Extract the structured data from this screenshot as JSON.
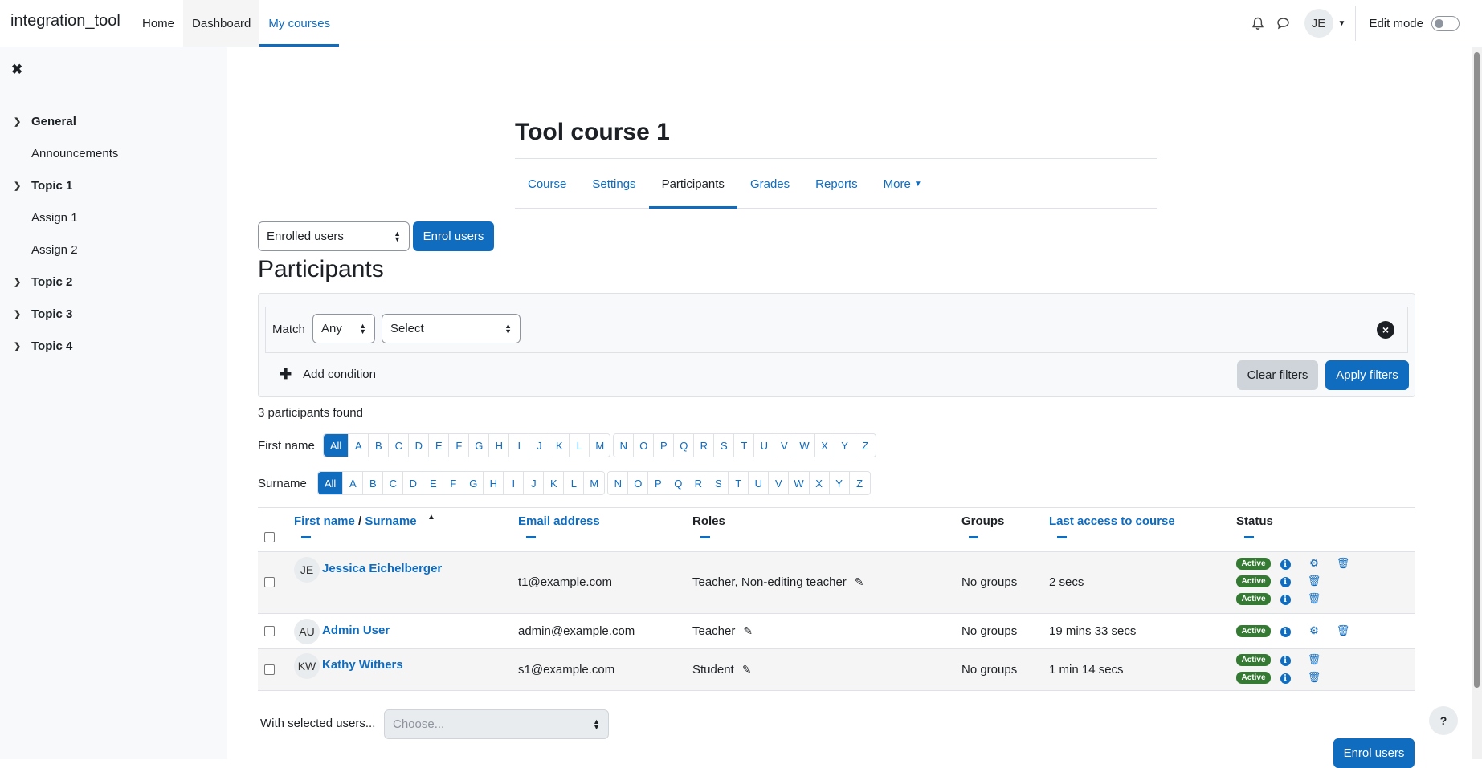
{
  "brand": "integration_tool",
  "primary_nav": [
    "Home",
    "Dashboard",
    "My courses"
  ],
  "user": {
    "initials": "JE"
  },
  "edit_mode_label": "Edit mode",
  "drawer": {
    "sections": [
      {
        "title": "General",
        "items": [
          "Announcements"
        ]
      },
      {
        "title": "Topic 1",
        "items": [
          "Assign 1",
          "Assign 2"
        ]
      },
      {
        "title": "Topic 2",
        "items": []
      },
      {
        "title": "Topic 3",
        "items": []
      },
      {
        "title": "Topic 4",
        "items": []
      }
    ]
  },
  "course_title": "Tool course 1",
  "secondary_nav": [
    "Course",
    "Settings",
    "Participants",
    "Grades",
    "Reports",
    "More"
  ],
  "enrolled_select": "Enrolled users",
  "enrol_button": "Enrol users",
  "participants_heading": "Participants",
  "filter": {
    "match_label": "Match",
    "match_value": "Any",
    "type_value": "Select",
    "add_condition": "Add condition",
    "clear": "Clear filters",
    "apply": "Apply filters"
  },
  "found_text": "3 participants found",
  "initials_bar": {
    "first_label": "First name",
    "surname_label": "Surname",
    "all": "All",
    "group1": [
      "A",
      "B",
      "C",
      "D",
      "E",
      "F",
      "G",
      "H",
      "I",
      "J",
      "K",
      "L",
      "M"
    ],
    "group2": [
      "N",
      "O",
      "P",
      "Q",
      "R",
      "S",
      "T",
      "U",
      "V",
      "W",
      "X",
      "Y",
      "Z"
    ]
  },
  "table": {
    "headers": {
      "first_name": "First name",
      "separator": "/",
      "surname": "Surname",
      "email": "Email address",
      "roles": "Roles",
      "groups": "Groups",
      "last_access": "Last access to course",
      "status": "Status"
    },
    "rows": [
      {
        "initials": "JE",
        "name": "Jessica Eichelberger",
        "email": "t1@example.com",
        "roles": "Teacher, Non-editing teacher",
        "groups": "No groups",
        "last_access": "2 secs",
        "status": "Active"
      },
      {
        "initials": "AU",
        "name": "Admin User",
        "email": "admin@example.com",
        "roles": "Teacher",
        "groups": "No groups",
        "last_access": "19 mins 33 secs",
        "status": "Active"
      },
      {
        "initials": "KW",
        "name": "Kathy Withers",
        "email": "s1@example.com",
        "roles": "Student",
        "groups": "No groups",
        "last_access": "1 min 14 secs",
        "status": "Active"
      }
    ]
  },
  "with_selected_label": "With selected users...",
  "choose_placeholder": "Choose...",
  "help": "?"
}
